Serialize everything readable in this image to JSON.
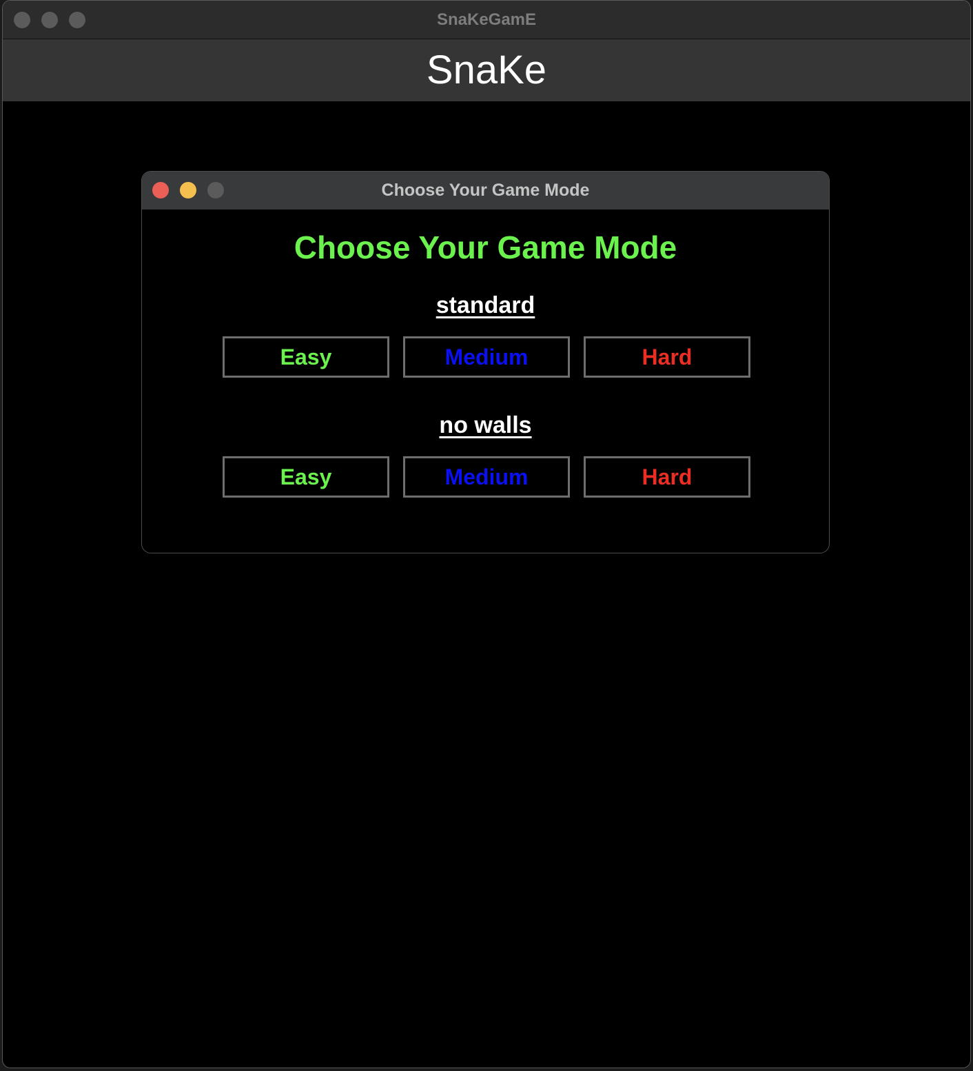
{
  "window": {
    "title": "SnaKeGamE"
  },
  "app": {
    "title": "SnaKe"
  },
  "dialog": {
    "title": "Choose Your Game Mode",
    "heading": "Choose Your Game Mode",
    "sections": [
      {
        "label": "standard",
        "buttons": [
          {
            "label": "Easy",
            "color": "#6cf24e"
          },
          {
            "label": "Medium",
            "color": "#0a10f0"
          },
          {
            "label": "Hard",
            "color": "#ea2e24"
          }
        ]
      },
      {
        "label": "no walls",
        "buttons": [
          {
            "label": "Easy",
            "color": "#6cf24e"
          },
          {
            "label": "Medium",
            "color": "#0a10f0"
          },
          {
            "label": "Hard",
            "color": "#ea2e24"
          }
        ]
      }
    ]
  },
  "colors": {
    "heading_green": "#6cf24e",
    "close_red": "#ec5f57",
    "minimize_yellow": "#f5bf4f",
    "zoom_gray": "#5b5b5b"
  }
}
